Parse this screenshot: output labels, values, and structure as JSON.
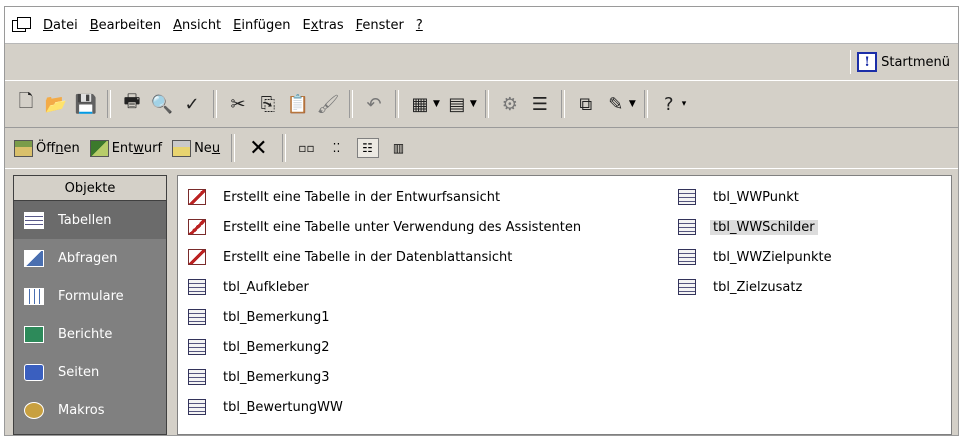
{
  "menubar": {
    "items": [
      {
        "prefix": "",
        "accel": "D",
        "rest": "atei"
      },
      {
        "prefix": "",
        "accel": "B",
        "rest": "earbeiten"
      },
      {
        "prefix": "",
        "accel": "A",
        "rest": "nsicht"
      },
      {
        "prefix": "",
        "accel": "E",
        "rest": "infügen"
      },
      {
        "prefix": "E",
        "accel": "x",
        "rest": "tras"
      },
      {
        "prefix": "",
        "accel": "F",
        "rest": "enster"
      },
      {
        "prefix": "",
        "accel": "?",
        "rest": ""
      }
    ]
  },
  "strip": {
    "start_icon": "!",
    "start_label": "Startmenü"
  },
  "toolbar": {
    "icons": [
      "new-icon",
      "open-icon",
      "save-icon",
      "print-icon",
      "print-preview-icon",
      "spelling-icon",
      "cut-icon",
      "copy-icon",
      "paste-icon",
      "format-painter-icon",
      "undo-icon",
      "office-links-icon",
      "analyze-icon",
      "code-icon",
      "properties-icon",
      "relationships-icon",
      "new-object-icon",
      "help-icon"
    ]
  },
  "toolbar2": {
    "open": {
      "prefix": "Öff",
      "accel": "n",
      "rest": "en"
    },
    "design": {
      "prefix": "Ent",
      "accel": "w",
      "rest": "urf"
    },
    "new": {
      "prefix": "Ne",
      "accel": "u",
      "rest": ""
    },
    "delete_glyph": "✕",
    "views": [
      "large-icons-view",
      "small-icons-view",
      "list-view",
      "details-view"
    ]
  },
  "objects": {
    "header": "Objekte",
    "items": [
      {
        "label": "Tabellen",
        "icon": "table-icon",
        "active": true
      },
      {
        "label": "Abfragen",
        "icon": "query-icon",
        "active": false
      },
      {
        "label": "Formulare",
        "icon": "form-icon",
        "active": false
      },
      {
        "label": "Berichte",
        "icon": "report-icon",
        "active": false
      },
      {
        "label": "Seiten",
        "icon": "page-icon",
        "active": false
      },
      {
        "label": "Makros",
        "icon": "macro-icon",
        "active": false
      }
    ]
  },
  "list": {
    "column1": [
      {
        "label": "Erstellt eine Tabelle in der Entwurfsansicht",
        "kind": "wizard"
      },
      {
        "label": "Erstellt eine Tabelle unter Verwendung des Assistenten",
        "kind": "wizard"
      },
      {
        "label": "Erstellt eine Tabelle in der Datenblattansicht",
        "kind": "wizard"
      },
      {
        "label": "tbl_Aufkleber",
        "kind": "table"
      },
      {
        "label": "tbl_Bemerkung1",
        "kind": "table"
      },
      {
        "label": "tbl_Bemerkung2",
        "kind": "table"
      },
      {
        "label": "tbl_Bemerkung3",
        "kind": "table"
      },
      {
        "label": "tbl_BewertungWW",
        "kind": "table"
      }
    ],
    "column2": [
      {
        "label": "tbl_WWPunkt",
        "kind": "table"
      },
      {
        "label": "tbl_WWSchilder",
        "kind": "table",
        "selected": true
      },
      {
        "label": "tbl_WWZielpunkte",
        "kind": "table"
      },
      {
        "label": "tbl_Zielzusatz",
        "kind": "table"
      }
    ]
  }
}
